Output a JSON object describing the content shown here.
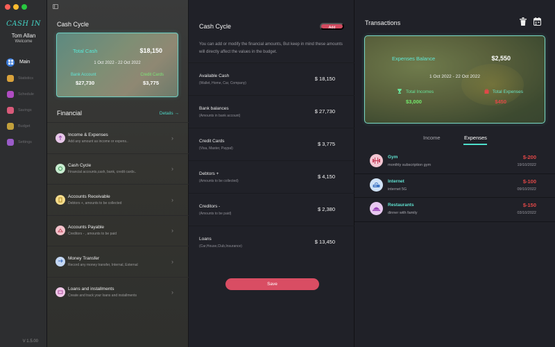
{
  "colors": {
    "accent": "#43d3c6",
    "danger": "#e34848",
    "save": "#d94d63",
    "active_nav": "#3b7bd9"
  },
  "sidebar": {
    "logo": "CASH IN",
    "user_name": "Tom Allan",
    "user_sub": "Welcome",
    "items": [
      {
        "label": "Main",
        "icon": "grid-icon",
        "color": "#3b7bd9"
      },
      {
        "label": "Statistics",
        "icon": "chart-icon",
        "color": "#d9a23b"
      },
      {
        "label": "Schedule",
        "icon": "calendar-icon",
        "color": "#b04cc2"
      },
      {
        "label": "Savings",
        "icon": "piggy-icon",
        "color": "#d95a7a"
      },
      {
        "label": "Budget",
        "icon": "budget-icon",
        "color": "#c2a03b"
      },
      {
        "label": "Settings",
        "icon": "gear-icon",
        "color": "#9b5cc9"
      }
    ],
    "version": "V 1.5.00"
  },
  "cash_cycle": {
    "title": "Cash Cycle",
    "total_label": "Total Cash",
    "total_value": "$18,150",
    "date_range": "1 Oct 2022 - 22 Oct 2022",
    "bank_label": "Bank Account",
    "bank_value": "$27,730",
    "credit_label": "Credit Cards",
    "credit_value": "$3,775"
  },
  "financial": {
    "title": "Financial",
    "details_label": "Details →",
    "items": [
      {
        "name": "Income & Expenses",
        "desc": "Add any amount as income or expens..",
        "icon_bg": "#e7c7e8"
      },
      {
        "name": "Cash Cycle",
        "desc": "Financial accounts,cash, bank, credit cards..",
        "icon_bg": "#c8ecd0"
      },
      {
        "name": "Accounts Receivable",
        "desc": "Debtors +, amounts to be collected",
        "icon_bg": "#f6dc8c"
      },
      {
        "name": "Accounts Payable",
        "desc": "Creditors - , amounts to be paid",
        "icon_bg": "#f4c2cb"
      },
      {
        "name": "Money Transfer",
        "desc": "Record any money transfer, Internal, External",
        "icon_bg": "#c4d8f4"
      },
      {
        "name": "Loans and installments",
        "desc": "Create and track your loans and installments",
        "icon_bg": "#f0c8e8"
      }
    ]
  },
  "editor": {
    "title": "Cash Cycle",
    "add_label": "Add",
    "description": "You can add or modify the financial amounts, But keep in mind these amounts will directly affect the values in the budget.",
    "rows": [
      {
        "name": "Available Cash",
        "desc": "(Wallet, Home, Car, Company)",
        "value": "$ 18,150"
      },
      {
        "name": "Bank balances",
        "desc": "(Amounts in bank account)",
        "value": "$ 27,730"
      },
      {
        "name": "Credit Cards",
        "desc": "(Visa, Master, Paypal)",
        "value": "$ 3,775"
      },
      {
        "name": "Debtors +",
        "desc": "(Amounts to be collected)",
        "value": "$ 4,150"
      },
      {
        "name": "Creditors -",
        "desc": "(Amounts to be paid)",
        "value": "$ 2,380"
      },
      {
        "name": "Loans",
        "desc": "(Car,House,Club,Insurance)",
        "value": "$ 13,450"
      }
    ],
    "save_label": "Save"
  },
  "transactions": {
    "title": "Transactions",
    "balance_label": "Expenses Balance",
    "balance_value": "$2,550",
    "date_range": "1 Oct 2022 - 22 Oct 2022",
    "income_label": "Total Incomes",
    "income_value": "$3,000",
    "expense_label": "Total Expenses",
    "expense_value": "$450",
    "tabs": [
      "Income",
      "Expenses"
    ],
    "active_tab": "Expenses",
    "items": [
      {
        "name": "Gym",
        "desc": "monthly subscription gym",
        "amount": "$-200",
        "date": "19/10/2022",
        "icon": "gym-icon",
        "bg": "#f3c6d2"
      },
      {
        "name": "Internet",
        "desc": "internet 5G",
        "amount": "$-100",
        "date": "09/10/2022",
        "icon": "router-icon",
        "bg": "#cfe2f6"
      },
      {
        "name": "Restaurants",
        "desc": "dinner with family",
        "amount": "$-150",
        "date": "03/10/2022",
        "icon": "restaurant-icon",
        "bg": "#e8c8f0"
      }
    ]
  }
}
